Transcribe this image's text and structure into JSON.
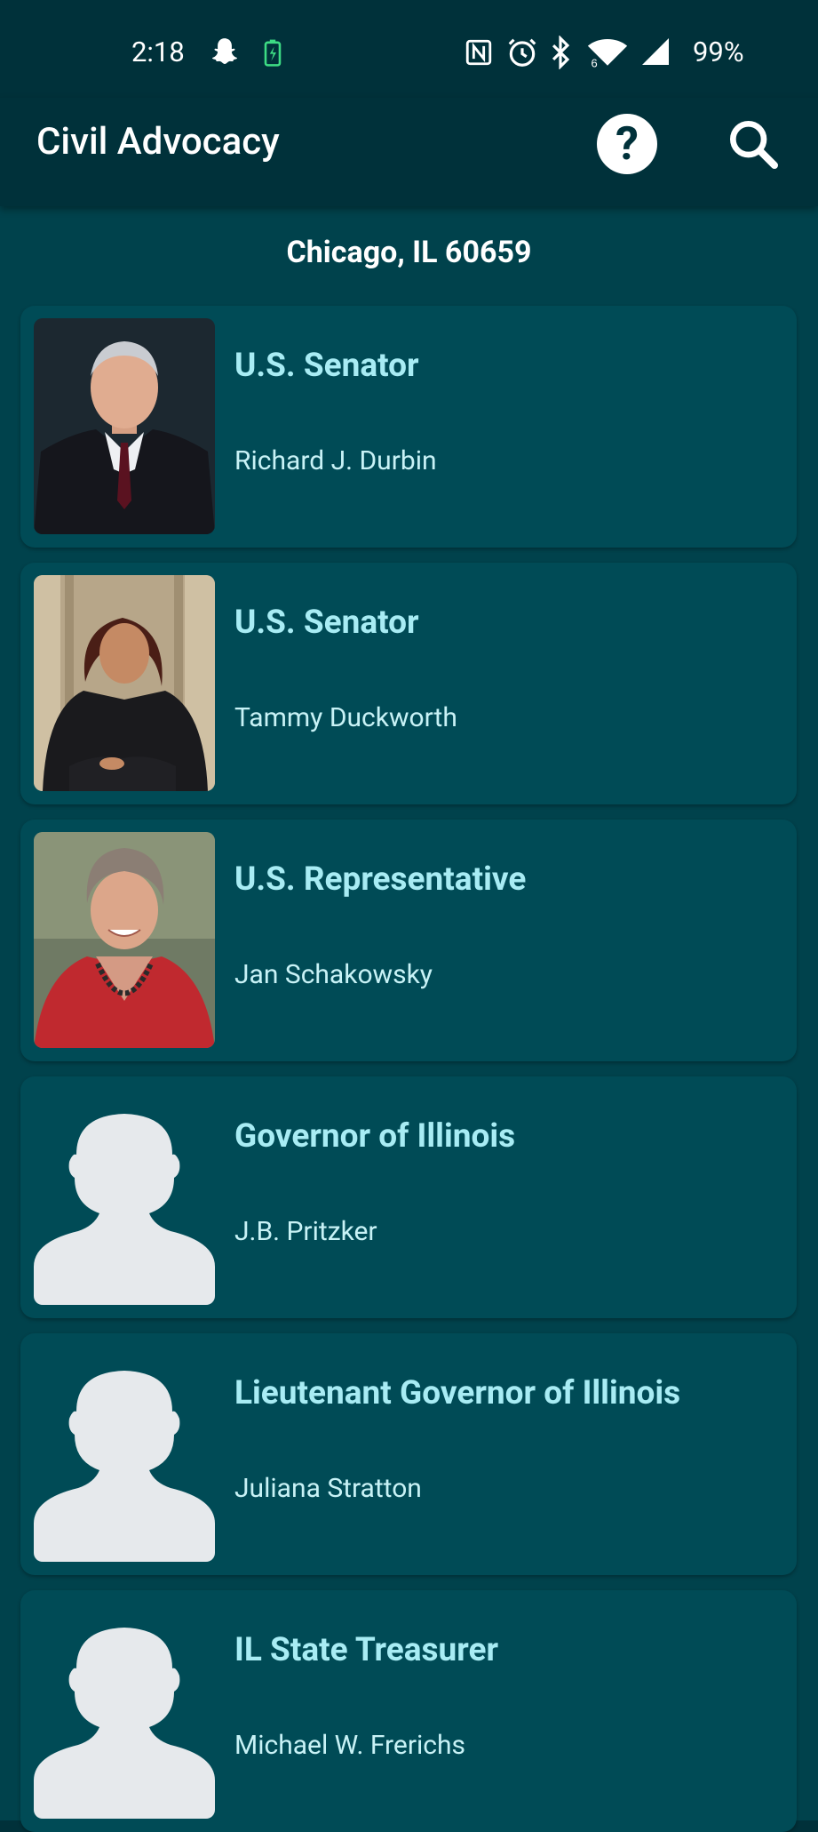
{
  "status_bar": {
    "time": "2:18",
    "battery": "99%",
    "icons": [
      "snapchat-icon",
      "battery-charging-icon",
      "nfc-icon",
      "alarm-icon",
      "bluetooth-icon",
      "wifi-icon",
      "signal-icon"
    ]
  },
  "app_bar": {
    "title": "Civil Advocacy",
    "icons": [
      "help-icon",
      "search-icon"
    ]
  },
  "location": "Chicago, IL 60659",
  "officials": [
    {
      "office": "U.S. Senator",
      "name": "Richard J. Durbin",
      "photo": "portrait-photo"
    },
    {
      "office": "U.S. Senator",
      "name": "Tammy Duckworth",
      "photo": "portrait-photo"
    },
    {
      "office": "U.S. Representative",
      "name": "Jan Schakowsky",
      "photo": "portrait-photo"
    },
    {
      "office": "Governor of Illinois",
      "name": "J.B. Pritzker",
      "photo": "placeholder-avatar-icon"
    },
    {
      "office": "Lieutenant Governor of Illinois",
      "name": "Juliana Stratton",
      "photo": "placeholder-avatar-icon"
    },
    {
      "office": "IL State Treasurer",
      "name": "Michael W. Frerichs",
      "photo": "placeholder-avatar-icon"
    }
  ],
  "colors": {
    "status_bar_bg": "#00313a",
    "content_bg": "#00424c",
    "card_bg": "#004b56",
    "office_text": "#a8ecf4",
    "name_text": "#c8f2f6"
  }
}
